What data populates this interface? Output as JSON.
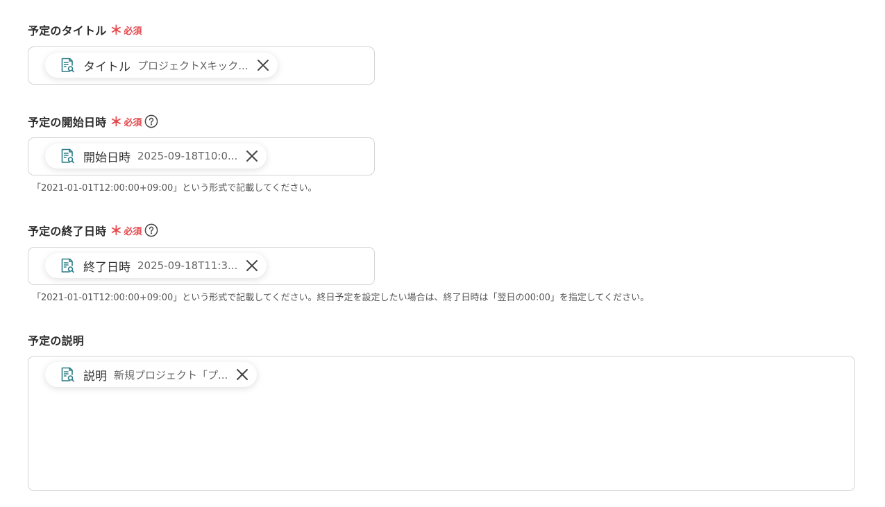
{
  "fields": {
    "title": {
      "label": "予定のタイトル",
      "required_mark": "＊",
      "required_text": "必須",
      "token": {
        "name": "タイトル",
        "value": "プロジェクトXキック..."
      }
    },
    "start": {
      "label": "予定の開始日時",
      "required_mark": "＊",
      "required_text": "必須",
      "token": {
        "name": "開始日時",
        "value": "2025-09-18T10:0..."
      },
      "hint": "「2021-01-01T12:00:00+09:00」という形式で記載してください。"
    },
    "end": {
      "label": "予定の終了日時",
      "required_mark": "＊",
      "required_text": "必須",
      "token": {
        "name": "終了日時",
        "value": "2025-09-18T11:3..."
      },
      "hint": "「2021-01-01T12:00:00+09:00」という形式で記載してください。終日予定を設定したい場合は、終了日時は「翌日の00:00」を指定してください。"
    },
    "description": {
      "label": "予定の説明",
      "token": {
        "name": "説明",
        "value": "新規プロジェクト「プ..."
      }
    }
  },
  "colors": {
    "required": "#e5484d",
    "icon_teal": "#2a7b86",
    "border": "#d4d4d4"
  },
  "icons": {
    "token": "document-search-icon",
    "remove": "close-icon",
    "help": "question-circle-icon"
  }
}
